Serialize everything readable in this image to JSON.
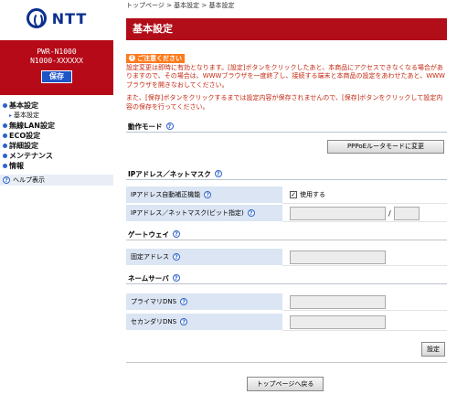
{
  "brand": {
    "logo_text": "NTT"
  },
  "model": {
    "line1": "PWR-N1000",
    "line2": "N1000-XXXXXX",
    "save_label": "保存"
  },
  "sidebar": {
    "items": [
      {
        "label": "基本設定",
        "bold": true
      },
      {
        "label": "基本設定",
        "sub": true
      },
      {
        "label": "無線LAN設定",
        "bold": true
      },
      {
        "label": "ECO設定",
        "bold": true
      },
      {
        "label": "詳細設定",
        "bold": true
      },
      {
        "label": "メンテナンス",
        "bold": true
      },
      {
        "label": "情報",
        "bold": true
      }
    ],
    "help_label": "ヘルプ表示"
  },
  "breadcrumb": "トップページ > 基本設定 > 基本設定",
  "page_title": "基本設定",
  "notice": {
    "label": "ご注意ください",
    "p1": "設定変更は即時に有効となります。[設定]ボタンをクリックしたあと、本商品にアクセスできなくなる場合がありますので、その場合は、WWWブラウザを一度終了し、接続する端末と本商品の設定をあわせたあと、WWWブラウザを開きなおしてください。",
    "p2": "また、[保存]ボタンをクリックするまでは設定内容が保存されませんので、[保存]ボタンをクリックして設定内容の保存を行ってください。"
  },
  "sections": {
    "mode": {
      "title": "動作モード",
      "button": "PPPoEルータモードに変更"
    },
    "ip": {
      "title": "IPアドレス／ネットマスク",
      "auto_label": "IPアドレス自動補正機能",
      "auto_value": "使用する",
      "ipmask_label": "IPアドレス／ネットマスク(ビット指定)",
      "slash": "/"
    },
    "gateway": {
      "title": "ゲートウェイ",
      "fixed_label": "固定アドレス"
    },
    "dns": {
      "title": "ネームサーバ",
      "primary_label": "プライマリDNS",
      "secondary_label": "セカンダリDNS"
    }
  },
  "buttons": {
    "set": "設定",
    "top": "トップページへ戻る"
  },
  "colors": {
    "accent_red": "#b10e19",
    "link_blue": "#2c63c9",
    "notice_orange": "#ff7a1a",
    "label_bg": "#dbe5f3"
  }
}
